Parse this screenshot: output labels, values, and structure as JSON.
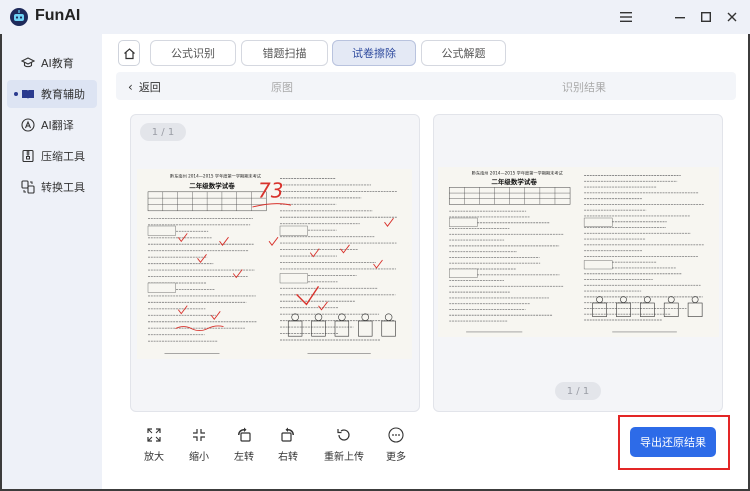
{
  "app": {
    "title": "FunAI"
  },
  "sidebar": {
    "items": [
      {
        "label": "AI教育",
        "icon": "graduation-cap-icon"
      },
      {
        "label": "教育辅助",
        "icon": "book-icon",
        "active": true
      },
      {
        "label": "AI翻译",
        "icon": "translate-icon"
      },
      {
        "label": "压缩工具",
        "icon": "compress-icon"
      },
      {
        "label": "转换工具",
        "icon": "convert-icon"
      }
    ]
  },
  "tabs": [
    {
      "label": "公式识别"
    },
    {
      "label": "错题扫描"
    },
    {
      "label": "试卷擦除",
      "active": true
    },
    {
      "label": "公式解题"
    }
  ],
  "subbar": {
    "back_label": "返回",
    "original_label": "原图",
    "result_label": "识别结果"
  },
  "left_panel": {
    "page_indicator": "1 / 1",
    "doc": {
      "header": "黔东南州 2014—2015 学年度第一学期期末考试",
      "title": "二年级数学试卷",
      "score_mark": "73"
    }
  },
  "right_panel": {
    "page_indicator": "1 / 1",
    "doc": {
      "header": "黔东南州 2014—2015 学年度第一学期期末考试",
      "title": "二年级数学试卷"
    }
  },
  "toolbar": [
    {
      "label": "放大",
      "icon": "expand-icon"
    },
    {
      "label": "缩小",
      "icon": "shrink-icon"
    },
    {
      "label": "左转",
      "icon": "rotate-left-icon"
    },
    {
      "label": "右转",
      "icon": "rotate-right-icon"
    },
    {
      "label": "重新上传",
      "icon": "reupload-icon"
    },
    {
      "label": "更多",
      "icon": "more-icon"
    }
  ],
  "export_button": {
    "label": "导出还原结果"
  },
  "colors": {
    "accent": "#2d6be8",
    "highlight": "#e32626",
    "sidebar_bg": "#eef1f8",
    "ink_red": "#d8322c"
  }
}
